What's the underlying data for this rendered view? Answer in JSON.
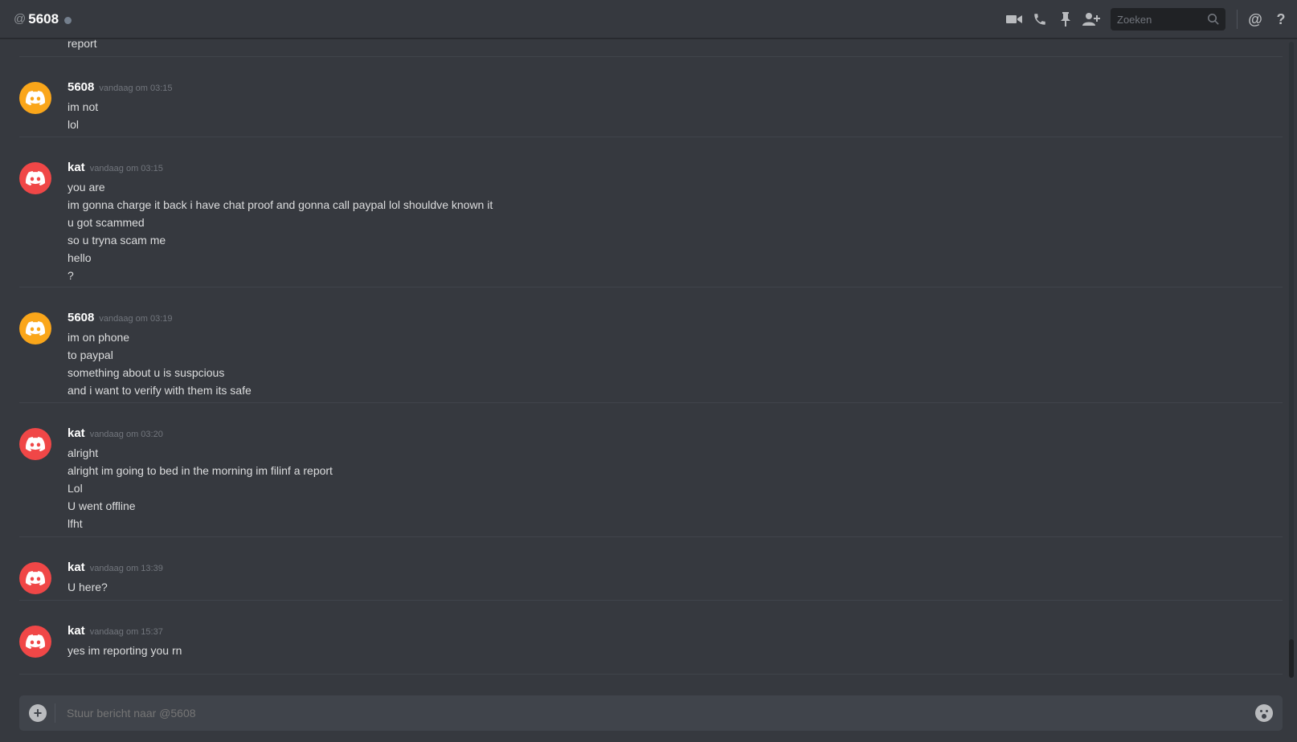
{
  "header": {
    "at_symbol": "@",
    "channel_name": "5608",
    "search_placeholder": "Zoeken",
    "status_color": "#747f8d"
  },
  "colors": {
    "yellow_avatar": "#faa61a",
    "red_avatar": "#f04747",
    "background": "#36393f"
  },
  "messages": {
    "top_fragment": "report",
    "groups": [
      {
        "author": "5608",
        "avatar_color": "yellow",
        "timestamp": "vandaag om 03:15",
        "lines": [
          "im not",
          "lol"
        ]
      },
      {
        "author": "kat",
        "avatar_color": "red",
        "timestamp": "vandaag om 03:15",
        "lines": [
          "you are",
          "im gonna charge it back i have chat proof and gonna call paypal lol shouldve known it",
          "u got scammed",
          "so u tryna scam me",
          "hello",
          "?"
        ]
      },
      {
        "author": "5608",
        "avatar_color": "yellow",
        "timestamp": "vandaag om 03:19",
        "lines": [
          "im on phone",
          "to paypal",
          "something about u is suspcious",
          "and i want to verify with them its safe"
        ]
      },
      {
        "author": "kat",
        "avatar_color": "red",
        "timestamp": "vandaag om 03:20",
        "lines": [
          "alright",
          "alright im going to bed in the morning im filinf a report",
          "Lol",
          "U went offline",
          "lfht"
        ]
      },
      {
        "author": "kat",
        "avatar_color": "red",
        "timestamp": "vandaag om 13:39",
        "lines": [
          "U here?"
        ]
      },
      {
        "author": "kat",
        "avatar_color": "red",
        "timestamp": "vandaag om 15:37",
        "lines": [
          "yes im reporting you rn"
        ]
      }
    ]
  },
  "composer": {
    "placeholder": "Stuur bericht naar @5608"
  },
  "icons": {
    "video": "video-call-icon",
    "phone": "voice-call-icon",
    "pin": "pin-icon",
    "add_friend": "add-friend-icon",
    "search": "search-icon",
    "mention": "mention-icon",
    "help": "help-icon",
    "upload": "plus-circle-icon",
    "emoji": "emoji-icon"
  }
}
